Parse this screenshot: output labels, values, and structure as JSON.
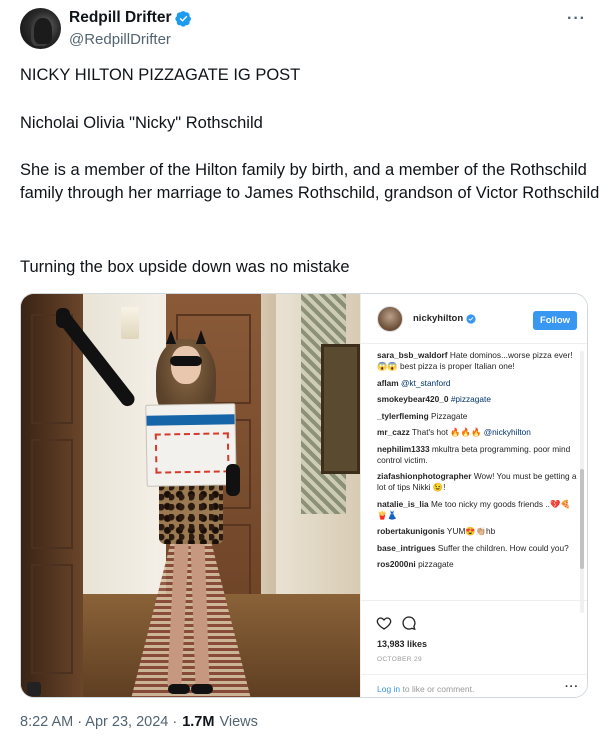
{
  "header": {
    "display_name": "Redpill Drifter",
    "handle": "@RedpillDrifter",
    "more_label": "···"
  },
  "post": {
    "lines": [
      "NICKY HILTON PIZZAGATE IG POST",
      "Nicholai Olivia \"Nicky\" Rothschild",
      "She is a member of the Hilton family by birth, and a member of the Rothschild family through her marriage to James Rothschild, grandson of Victor Rothschild",
      "Turning the box upside down was no mistake"
    ]
  },
  "instagram": {
    "username": "nickyhilton",
    "follow_label": "Follow",
    "comments": [
      {
        "user": "sara_bsb_waldorf",
        "text": "Hate dominos...worse pizza ever! 😱😱 best pizza is proper Italian one!"
      },
      {
        "user": "aflam",
        "mention": "@kt_stanford",
        "text": ""
      },
      {
        "user": "smokeybear420_0",
        "mention": "#pizzagate",
        "text": ""
      },
      {
        "user": "_tylerfleming",
        "text": "Pizzagate"
      },
      {
        "user": "mr_cazz",
        "text": "That's hot 🔥🔥🔥",
        "mention": "@nickyhilton"
      },
      {
        "user": "nephilim1333",
        "text": "mkultra beta programming. poor mind control victim."
      },
      {
        "user": "ziafashionphotographer",
        "text": "Wow! You must be getting a lot of tips Nikki 😉!"
      },
      {
        "user": "natalie_is_lia",
        "text": "Me too nicky my goods friends ..💔🍕🍟👗"
      },
      {
        "user": "robertakunigonis",
        "text": "YUM😍👏🏼hb"
      },
      {
        "user": "base_intrigues",
        "text": "Suffer the children. How could you?"
      },
      {
        "user": "ros2000ni",
        "text": "pizzagate"
      }
    ],
    "likes": "13,983 likes",
    "date": "OCTOBER 29",
    "login_link": "Log in",
    "login_rest": " to like or comment.",
    "more_label": "···"
  },
  "footer": {
    "timestamp": "8:22 AM · Apr 23, 2024 ·",
    "views_count": "1.7M",
    "views_label": "Views"
  },
  "colors": {
    "verified_blue": "#1d9bf0",
    "ig_blue": "#3897f0",
    "text_secondary": "#536471"
  }
}
